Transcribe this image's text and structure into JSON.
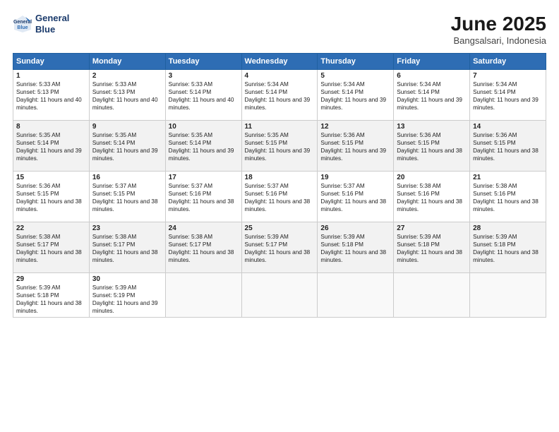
{
  "header": {
    "logo_line1": "General",
    "logo_line2": "Blue",
    "month": "June 2025",
    "location": "Bangsalsari, Indonesia"
  },
  "weekdays": [
    "Sunday",
    "Monday",
    "Tuesday",
    "Wednesday",
    "Thursday",
    "Friday",
    "Saturday"
  ],
  "weeks": [
    [
      {
        "day": "1",
        "rise": "5:33 AM",
        "set": "5:13 PM",
        "daylight": "11 hours and 40 minutes."
      },
      {
        "day": "2",
        "rise": "5:33 AM",
        "set": "5:13 PM",
        "daylight": "11 hours and 40 minutes."
      },
      {
        "day": "3",
        "rise": "5:33 AM",
        "set": "5:14 PM",
        "daylight": "11 hours and 40 minutes."
      },
      {
        "day": "4",
        "rise": "5:34 AM",
        "set": "5:14 PM",
        "daylight": "11 hours and 39 minutes."
      },
      {
        "day": "5",
        "rise": "5:34 AM",
        "set": "5:14 PM",
        "daylight": "11 hours and 39 minutes."
      },
      {
        "day": "6",
        "rise": "5:34 AM",
        "set": "5:14 PM",
        "daylight": "11 hours and 39 minutes."
      },
      {
        "day": "7",
        "rise": "5:34 AM",
        "set": "5:14 PM",
        "daylight": "11 hours and 39 minutes."
      }
    ],
    [
      {
        "day": "8",
        "rise": "5:35 AM",
        "set": "5:14 PM",
        "daylight": "11 hours and 39 minutes."
      },
      {
        "day": "9",
        "rise": "5:35 AM",
        "set": "5:14 PM",
        "daylight": "11 hours and 39 minutes."
      },
      {
        "day": "10",
        "rise": "5:35 AM",
        "set": "5:14 PM",
        "daylight": "11 hours and 39 minutes."
      },
      {
        "day": "11",
        "rise": "5:35 AM",
        "set": "5:15 PM",
        "daylight": "11 hours and 39 minutes."
      },
      {
        "day": "12",
        "rise": "5:36 AM",
        "set": "5:15 PM",
        "daylight": "11 hours and 39 minutes."
      },
      {
        "day": "13",
        "rise": "5:36 AM",
        "set": "5:15 PM",
        "daylight": "11 hours and 38 minutes."
      },
      {
        "day": "14",
        "rise": "5:36 AM",
        "set": "5:15 PM",
        "daylight": "11 hours and 38 minutes."
      }
    ],
    [
      {
        "day": "15",
        "rise": "5:36 AM",
        "set": "5:15 PM",
        "daylight": "11 hours and 38 minutes."
      },
      {
        "day": "16",
        "rise": "5:37 AM",
        "set": "5:15 PM",
        "daylight": "11 hours and 38 minutes."
      },
      {
        "day": "17",
        "rise": "5:37 AM",
        "set": "5:16 PM",
        "daylight": "11 hours and 38 minutes."
      },
      {
        "day": "18",
        "rise": "5:37 AM",
        "set": "5:16 PM",
        "daylight": "11 hours and 38 minutes."
      },
      {
        "day": "19",
        "rise": "5:37 AM",
        "set": "5:16 PM",
        "daylight": "11 hours and 38 minutes."
      },
      {
        "day": "20",
        "rise": "5:38 AM",
        "set": "5:16 PM",
        "daylight": "11 hours and 38 minutes."
      },
      {
        "day": "21",
        "rise": "5:38 AM",
        "set": "5:16 PM",
        "daylight": "11 hours and 38 minutes."
      }
    ],
    [
      {
        "day": "22",
        "rise": "5:38 AM",
        "set": "5:17 PM",
        "daylight": "11 hours and 38 minutes."
      },
      {
        "day": "23",
        "rise": "5:38 AM",
        "set": "5:17 PM",
        "daylight": "11 hours and 38 minutes."
      },
      {
        "day": "24",
        "rise": "5:38 AM",
        "set": "5:17 PM",
        "daylight": "11 hours and 38 minutes."
      },
      {
        "day": "25",
        "rise": "5:39 AM",
        "set": "5:17 PM",
        "daylight": "11 hours and 38 minutes."
      },
      {
        "day": "26",
        "rise": "5:39 AM",
        "set": "5:18 PM",
        "daylight": "11 hours and 38 minutes."
      },
      {
        "day": "27",
        "rise": "5:39 AM",
        "set": "5:18 PM",
        "daylight": "11 hours and 38 minutes."
      },
      {
        "day": "28",
        "rise": "5:39 AM",
        "set": "5:18 PM",
        "daylight": "11 hours and 38 minutes."
      }
    ],
    [
      {
        "day": "29",
        "rise": "5:39 AM",
        "set": "5:18 PM",
        "daylight": "11 hours and 38 minutes."
      },
      {
        "day": "30",
        "rise": "5:39 AM",
        "set": "5:19 PM",
        "daylight": "11 hours and 39 minutes."
      },
      null,
      null,
      null,
      null,
      null
    ]
  ]
}
